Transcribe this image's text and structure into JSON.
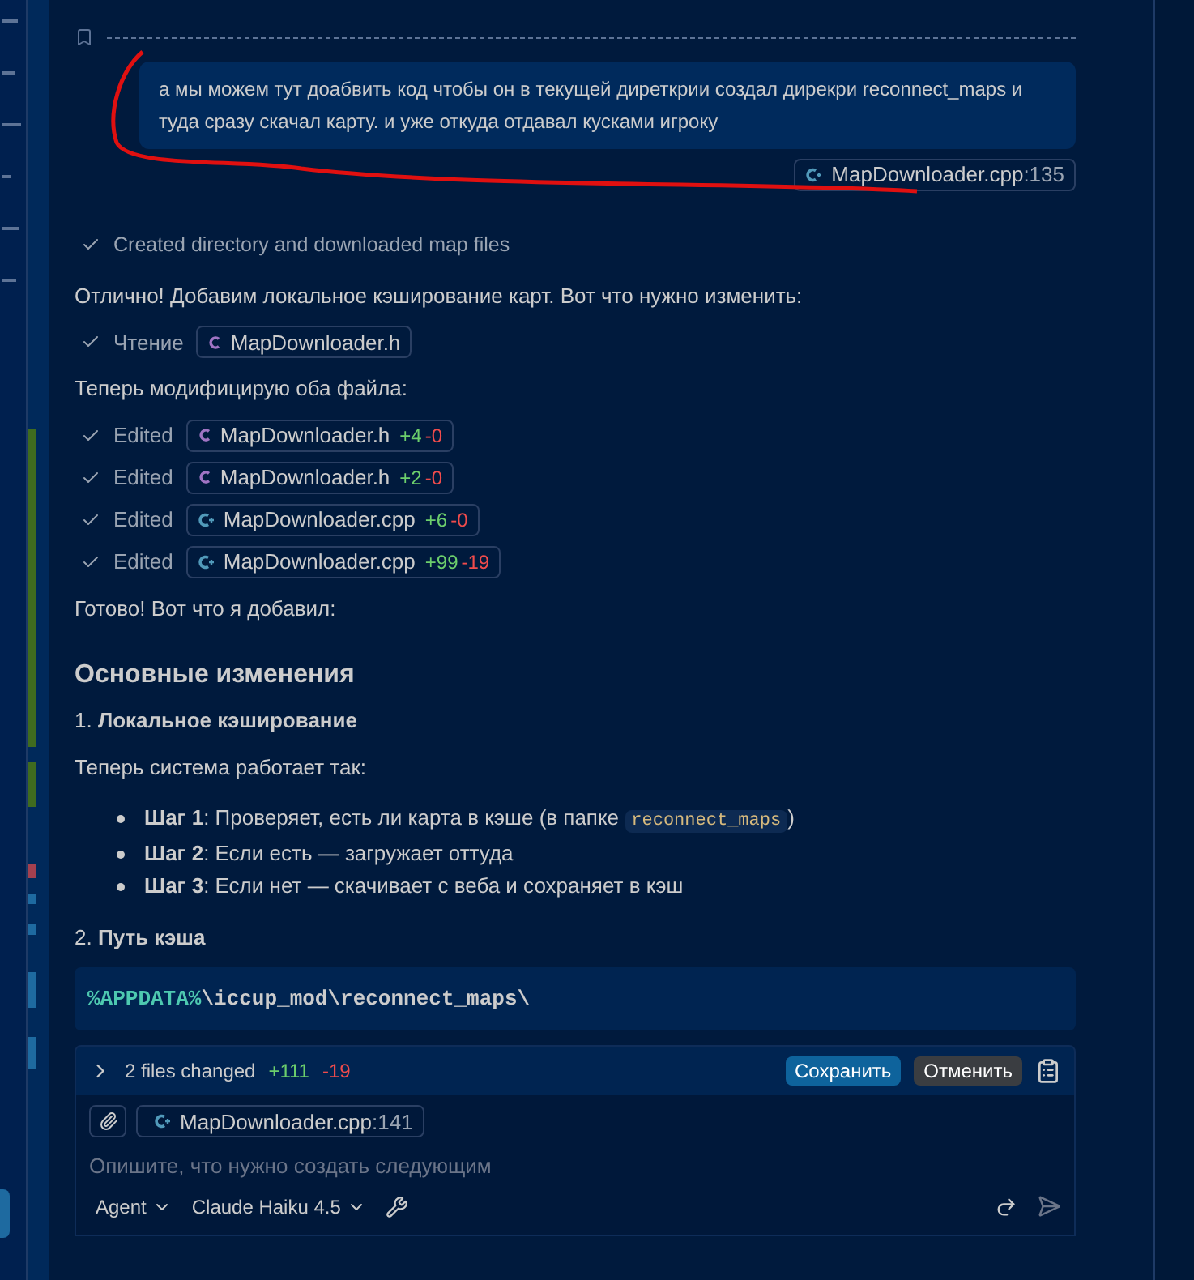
{
  "user_message": {
    "text": "а мы можем тут доабвить код чтобы он в текущей диреткрии создал дирекри reconnect_maps и туда сразу скачал карту. и уже откуда отдавал кусками игроку",
    "file_ref": {
      "name": "MapDownloader.cpp",
      "line": ":135",
      "kind": "cpp"
    }
  },
  "content": [
    {
      "kind": "status",
      "text": "Created directory and downloaded map files"
    },
    {
      "kind": "paragraph",
      "text": "Отлично! Добавим локальное кэширование карт. Вот что нужно изменить:"
    },
    {
      "kind": "tool",
      "label": "Чтение",
      "file": {
        "name": "MapDownloader.h",
        "kind": "h"
      }
    },
    {
      "kind": "paragraph",
      "text": "Теперь модифицирую оба файла:"
    },
    {
      "kind": "tool",
      "label": "Edited",
      "file": {
        "name": "MapDownloader.h",
        "kind": "h"
      },
      "added": "+4",
      "removed": "-0"
    },
    {
      "kind": "tool",
      "label": "Edited",
      "file": {
        "name": "MapDownloader.h",
        "kind": "h"
      },
      "added": "+2",
      "removed": "-0"
    },
    {
      "kind": "tool",
      "label": "Edited",
      "file": {
        "name": "MapDownloader.cpp",
        "kind": "cpp"
      },
      "added": "+6",
      "removed": "-0"
    },
    {
      "kind": "tool",
      "label": "Edited",
      "file": {
        "name": "MapDownloader.cpp",
        "kind": "cpp"
      },
      "added": "+99",
      "removed": "-19"
    },
    {
      "kind": "paragraph",
      "text": "Готово! Вот что я добавил:"
    },
    {
      "kind": "heading",
      "text": "Основные изменения"
    },
    {
      "kind": "numbered",
      "number": "1.",
      "text": "Локальное кэширование"
    },
    {
      "kind": "paragraph",
      "text": "Теперь система работает так:"
    },
    {
      "kind": "bullets",
      "items": [
        {
          "label": "Шаг 1",
          "text": ": Проверяет, есть ли карта в кэше (в папке ",
          "code": "reconnect_maps",
          "text_after": ")"
        },
        {
          "label": "Шаг 2",
          "text": ": Если есть — загружает оттуда"
        },
        {
          "label": "Шаг 3",
          "text": ": Если нет — скачивает с веба и сохраняет в кэш"
        }
      ]
    },
    {
      "kind": "numbered",
      "number": "2.",
      "text": "Путь кэша"
    },
    {
      "kind": "code",
      "text": "%APPDATA%\\iccup_mod\\reconnect_maps\\"
    }
  ],
  "changes_bar": {
    "summary": "2 files changed",
    "added": "+111",
    "removed": "-19",
    "buttons": [
      {
        "label": "Сохранить",
        "kind": "primary"
      },
      {
        "label": "Отменить",
        "kind": "secondary"
      }
    ]
  },
  "input": {
    "context_file": {
      "name": "MapDownloader.cpp",
      "line": ":141",
      "kind": "cpp"
    },
    "placeholder": "Опишите, что нужно создать следующим",
    "mode": "Agent",
    "model": "Claude Haiku 4.5"
  }
}
